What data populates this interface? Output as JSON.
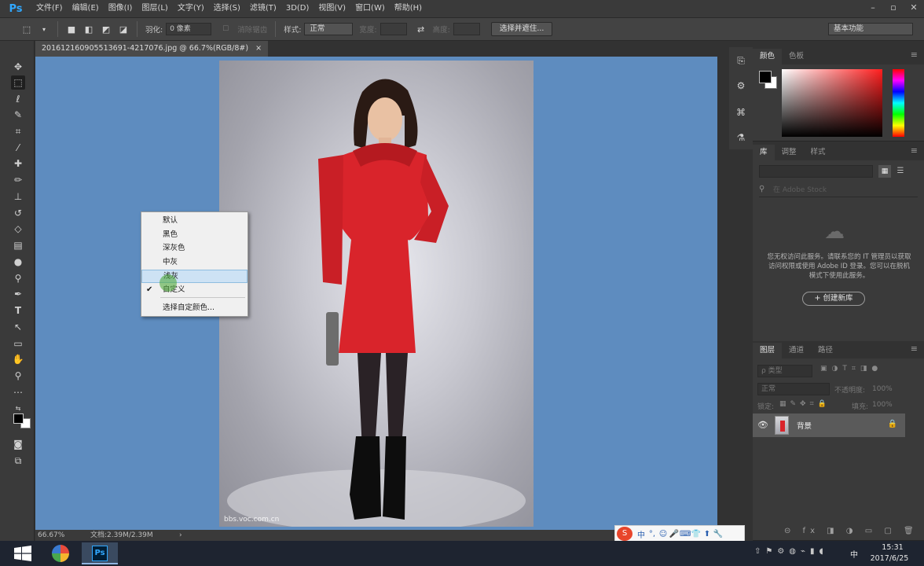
{
  "app": {
    "logo": "Ps",
    "menus": [
      "文件(F)",
      "编辑(E)",
      "图像(I)",
      "图层(L)",
      "文字(Y)",
      "选择(S)",
      "滤镜(T)",
      "3D(D)",
      "视图(V)",
      "窗口(W)",
      "帮助(H)"
    ],
    "window_controls": [
      "–",
      "▫",
      "✕"
    ]
  },
  "options_bar": {
    "feather_label": "羽化:",
    "feather_value": "0 像素",
    "antialias_label": "消除锯齿",
    "style_label": "样式:",
    "style_value": "正常",
    "width_label": "宽度:",
    "height_label": "高度:",
    "select_mask_button": "选择并遮住...",
    "workspace": "基本功能"
  },
  "document": {
    "tab_title": "201612160905513691-4217076.jpg @ 66.7%(RGB/8#)",
    "tab_close": "×",
    "watermark": "bbs.voc.com.cn",
    "zoom": "66.67%",
    "doc_size": "文档:2.39M/2.39M",
    "status_arrow": "›"
  },
  "context_menu": {
    "items": [
      "默认",
      "黑色",
      "深灰色",
      "中灰",
      "浅灰",
      "自定义",
      "选择自定颜色..."
    ],
    "hover_index": 4,
    "checked_index": 5,
    "check_mark": "✔"
  },
  "color_panel": {
    "tabs": [
      "颜色",
      "色板"
    ],
    "foreground": "#000000",
    "background": "#ffffff",
    "hue": "#ff1e1e"
  },
  "libraries_panel": {
    "tabs": [
      "库",
      "调整",
      "样式"
    ],
    "search_placeholder": "在 Adobe Stock",
    "message": "您无权访问此服务。请联系您的 IT 管理员以获取访问权限或使用 Adobe ID 登录。您可以在脱机模式下使用此服务。",
    "create_button": "+ 创建新库"
  },
  "layers_panel": {
    "tabs": [
      "图层",
      "通道",
      "路径"
    ],
    "filter_kind": "ρ 类型",
    "blend_mode": "正常",
    "opacity_label": "不透明度:",
    "opacity_value": "100%",
    "lock_label": "锁定:",
    "fill_label": "填充:",
    "fill_value": "100%",
    "layers": [
      {
        "name": "背景",
        "visible": true,
        "locked": true
      }
    ],
    "footer_icons": "⊝ fx ◨ ◑ ▭ ▢ 🗑"
  },
  "ime_bar": {
    "logo": "S",
    "items": [
      "中",
      "°,",
      "☺",
      "🎤",
      "⌨",
      "👕",
      "⬆",
      "🔧"
    ]
  },
  "taskbar": {
    "ime_indicator": "中",
    "time": "15:31",
    "date": "2017/6/25"
  },
  "colors": {
    "canvas_bg": "#5e8cbf",
    "dress": "#d9242b",
    "accent": "#31a8ff"
  }
}
